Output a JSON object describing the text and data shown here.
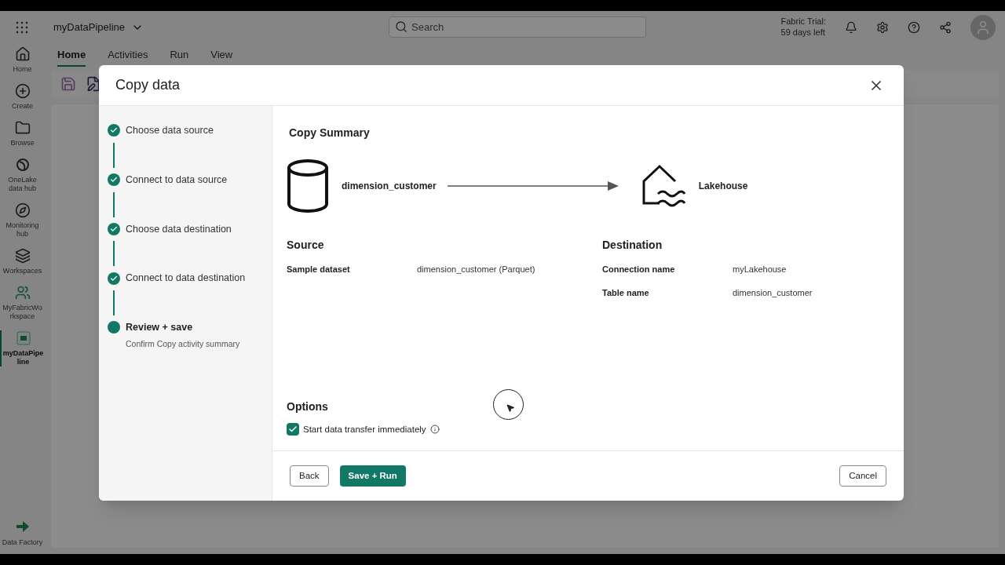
{
  "app": {
    "title": "myDataPipeline",
    "search": {
      "placeholder": "Search"
    },
    "trial": [
      "Fabric Trial:",
      "59 days left"
    ]
  },
  "ribbon_tabs": [
    {
      "label": "Home",
      "selected": true
    },
    {
      "label": "Activities",
      "selected": false
    },
    {
      "label": "Run",
      "selected": false
    },
    {
      "label": "View",
      "selected": false
    }
  ],
  "nav": [
    {
      "label": "Home",
      "selected": false
    },
    {
      "label": "Create",
      "selected": false
    },
    {
      "label": "Browse",
      "selected": false
    },
    {
      "label": "OneLake data hub",
      "selected": false
    },
    {
      "label": "Monitoring hub",
      "selected": false
    },
    {
      "label": "Workspaces",
      "selected": false
    },
    {
      "label": "MyFabricWorkspace",
      "selected": false
    },
    {
      "label": "myDataPipeline",
      "selected": true
    }
  ],
  "nav_footer": "Data Factory",
  "dialog": {
    "title": "Copy data",
    "steps": [
      {
        "label": "Choose data source",
        "completed": true,
        "selected": false
      },
      {
        "label": "Connect to data source",
        "completed": true,
        "selected": false
      },
      {
        "label": "Choose data destination",
        "completed": true,
        "selected": false
      },
      {
        "label": "Connect to data destination",
        "completed": true,
        "selected": false
      },
      {
        "label": "Review + save",
        "completed": false,
        "selected": true,
        "subtitle": "Confirm Copy activity summary"
      }
    ],
    "summary_title": "Copy Summary",
    "source_name": "dimension_customer",
    "destination_name": "Lakehouse",
    "source": {
      "heading": "Source",
      "rows": [
        {
          "label": "Sample dataset",
          "value": "dimension_customer (Parquet)"
        }
      ]
    },
    "destination": {
      "heading": "Destination",
      "rows": [
        {
          "label": "Connection name",
          "value": "myLakehouse"
        },
        {
          "label": "Table name",
          "value": "dimension_customer"
        }
      ]
    },
    "options": {
      "heading": "Options",
      "checkbox": {
        "label": "Start data transfer immediately",
        "checked": true
      }
    },
    "buttons": {
      "back": "Back",
      "primary": "Save + Run",
      "cancel": "Cancel"
    }
  }
}
